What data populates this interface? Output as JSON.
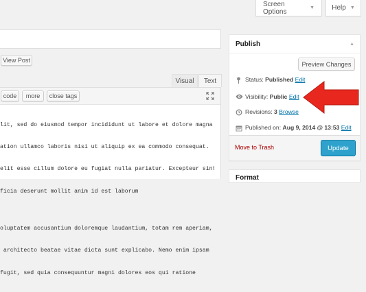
{
  "screen_meta": {
    "screen_options_label": "Screen Options",
    "help_label": "Help"
  },
  "permalink": {
    "view_post_label": "View Post"
  },
  "editor": {
    "tabs": {
      "visual": "Visual",
      "text": "Text"
    },
    "quicktags": [
      "code",
      "more",
      "close tags"
    ],
    "lines": [
      "lit, sed do eiusmod tempor incididunt ut labore et dolore magna",
      "ation ullamco laboris nisi ut aliquip ex ea commodo consequat.",
      "elit esse cillum dolore eu fugiat nulla pariatur. Excepteur sint",
      "ficia deserunt mollit anim id est laborum",
      "",
      "oluptatem accusantium doloremque laudantium, totam rem aperiam,",
      " architecto beatae vitae dicta sunt explicabo. Nemo enim ipsam",
      "fugit, sed quia consequuntur magni dolores eos qui ratione"
    ]
  },
  "publish": {
    "title": "Publish",
    "preview_label": "Preview Changes",
    "status_label": "Status:",
    "status_value": "Published",
    "status_edit": "Edit",
    "visibility_label": "Visibility:",
    "visibility_value": "Public",
    "visibility_edit": "Edit",
    "revisions_label": "Revisions:",
    "revisions_value": "3",
    "revisions_link": "Browse",
    "published_label": "Published on:",
    "published_value": "Aug 9, 2014 @ 13:53",
    "published_edit": "Edit",
    "trash_label": "Move to Trash",
    "update_label": "Update",
    "accent_color": "#2ea2cc",
    "arrow_color": "#e8281e"
  },
  "format_box": {
    "title": "Format"
  }
}
